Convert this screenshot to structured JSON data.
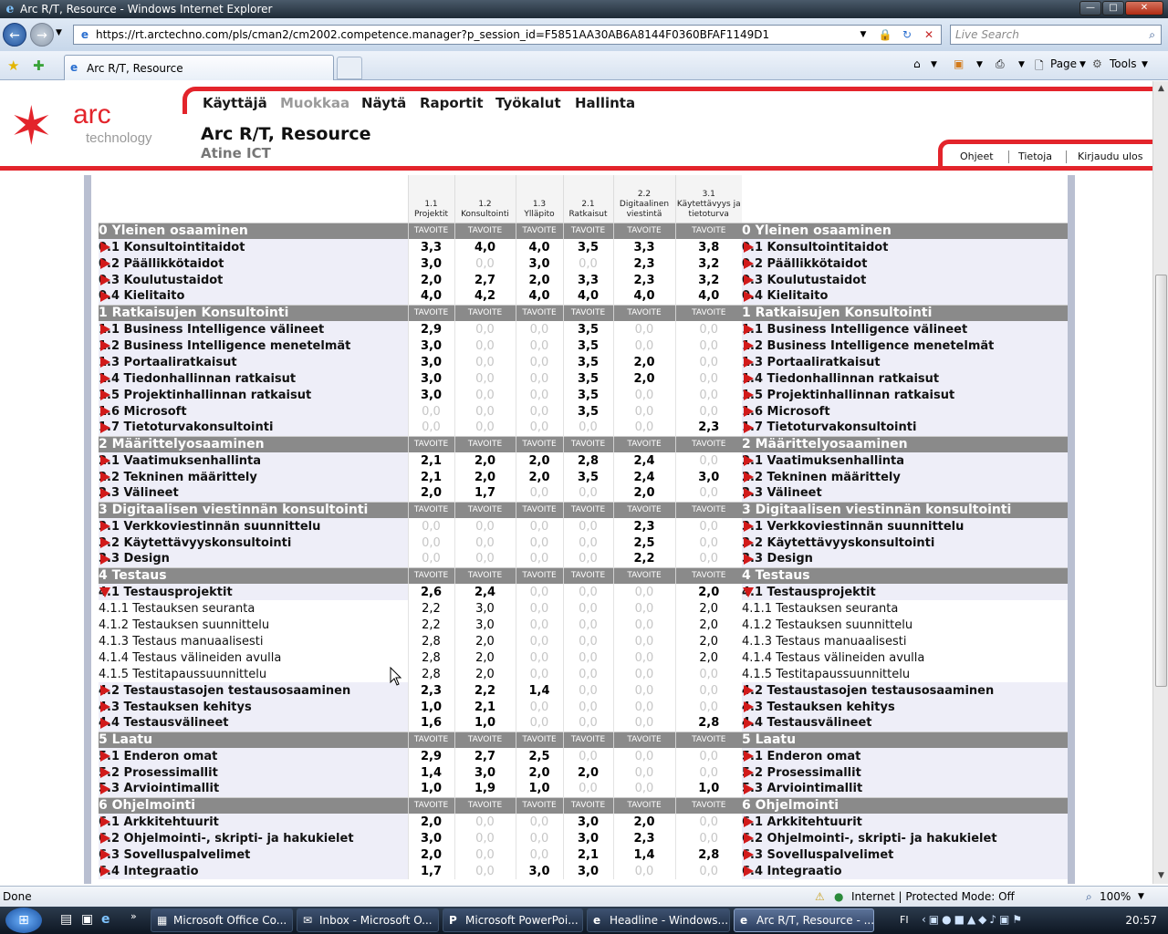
{
  "window": {
    "title": "Arc R/T, Resource - Windows Internet Explorer"
  },
  "browser": {
    "url": "https://rt.arctechno.com/pls/cman2/cm2002.competence.manager?p_session_id=F5851AA30AB6A8144F0360BFAF1149D1",
    "search_placeholder": "Live Search",
    "tab_title": "Arc R/T, Resource",
    "page_label": "Page",
    "tools_label": "Tools"
  },
  "app": {
    "logo_text": "arc",
    "logo_sub": "technology",
    "menu": [
      "Käyttäjä",
      "Muokkaa",
      "Näytä",
      "Raportit",
      "Työkalut",
      "Hallinta"
    ],
    "title": "Arc R/T, Resource",
    "subtitle": "Atine ICT",
    "top_links": [
      "Ohjeet",
      "Tietoja",
      "Kirjaudu ulos"
    ]
  },
  "grid": {
    "tav": "TAVOITE",
    "columns": [
      {
        "num": "1.1",
        "name": "Projektit"
      },
      {
        "num": "1.2",
        "name": "Konsultointi"
      },
      {
        "num": "1.3",
        "name": "Ylläpito"
      },
      {
        "num": "2.1",
        "name": "Ratkaisut"
      },
      {
        "num": "2.2",
        "name": "Digitaalinen viestintä"
      },
      {
        "num": "3.1",
        "name": "Käytettävyys ja tietoturva"
      }
    ],
    "rows": [
      {
        "type": "sec",
        "label": "0 Yleinen osaaminen"
      },
      {
        "label": "0.1 Konsultointitaidot",
        "values": [
          "3,3",
          "4,0",
          "4,0",
          "3,5",
          "3,3",
          "3,8"
        ]
      },
      {
        "label": "0.2 Päällikkötaidot",
        "values": [
          "3,0",
          "0,0",
          "3,0",
          "0,0",
          "2,3",
          "3,2"
        ]
      },
      {
        "label": "0.3 Koulutustaidot",
        "values": [
          "2,0",
          "2,7",
          "2,0",
          "3,3",
          "2,3",
          "3,2"
        ]
      },
      {
        "label": "0.4 Kielitaito",
        "values": [
          "4,0",
          "4,2",
          "4,0",
          "4,0",
          "4,0",
          "4,0"
        ]
      },
      {
        "type": "sec",
        "label": "1 Ratkaisujen Konsultointi"
      },
      {
        "label": "1.1 Business Intelligence välineet",
        "values": [
          "2,9",
          "0,0",
          "0,0",
          "3,5",
          "0,0",
          "0,0"
        ]
      },
      {
        "label": "1.2 Business Intelligence menetelmät",
        "values": [
          "3,0",
          "0,0",
          "0,0",
          "3,5",
          "0,0",
          "0,0"
        ]
      },
      {
        "label": "1.3 Portaaliratkaisut",
        "values": [
          "3,0",
          "0,0",
          "0,0",
          "3,5",
          "2,0",
          "0,0"
        ]
      },
      {
        "label": "1.4 Tiedonhallinnan ratkaisut",
        "values": [
          "3,0",
          "0,0",
          "0,0",
          "3,5",
          "2,0",
          "0,0"
        ]
      },
      {
        "label": "1.5 Projektinhallinnan ratkaisut",
        "values": [
          "3,0",
          "0,0",
          "0,0",
          "3,5",
          "0,0",
          "0,0"
        ]
      },
      {
        "label": "1.6 Microsoft",
        "values": [
          "0,0",
          "0,0",
          "0,0",
          "3,5",
          "0,0",
          "0,0"
        ]
      },
      {
        "label": "1.7 Tietoturvakonsultointi",
        "values": [
          "0,0",
          "0,0",
          "0,0",
          "0,0",
          "0,0",
          "2,3"
        ]
      },
      {
        "type": "sec",
        "label": "2 Määrittelyosaaminen"
      },
      {
        "label": "2.1 Vaatimuksenhallinta",
        "values": [
          "2,1",
          "2,0",
          "2,0",
          "2,8",
          "2,4",
          "0,0"
        ]
      },
      {
        "label": "2.2 Tekninen määrittely",
        "values": [
          "2,1",
          "2,0",
          "2,0",
          "3,5",
          "2,4",
          "3,0"
        ]
      },
      {
        "label": "2.3 Välineet",
        "values": [
          "2,0",
          "1,7",
          "0,0",
          "0,0",
          "2,0",
          "0,0"
        ]
      },
      {
        "type": "sec",
        "label": "3 Digitaalisen viestinnän konsultointi"
      },
      {
        "label": "3.1 Verkkoviestinnän suunnittelu",
        "values": [
          "0,0",
          "0,0",
          "0,0",
          "0,0",
          "2,3",
          "0,0"
        ]
      },
      {
        "label": "3.2 Käytettävyyskonsultointi",
        "values": [
          "0,0",
          "0,0",
          "0,0",
          "0,0",
          "2,5",
          "0,0"
        ]
      },
      {
        "label": "3.3 Design",
        "values": [
          "0,0",
          "0,0",
          "0,0",
          "0,0",
          "2,2",
          "0,0"
        ]
      },
      {
        "type": "sec",
        "label": "4 Testaus"
      },
      {
        "label": "4.1 Testausprojektit",
        "expanded": true,
        "values": [
          "2,6",
          "2,4",
          "0,0",
          "0,0",
          "0,0",
          "2,0"
        ]
      },
      {
        "sub": true,
        "label": "4.1.1 Testauksen seuranta",
        "values": [
          "2,2",
          "3,0",
          "0,0",
          "0,0",
          "0,0",
          "2,0"
        ]
      },
      {
        "sub": true,
        "label": "4.1.2 Testauksen suunnittelu",
        "values": [
          "2,2",
          "3,0",
          "0,0",
          "0,0",
          "0,0",
          "2,0"
        ]
      },
      {
        "sub": true,
        "label": "4.1.3 Testaus manuaalisesti",
        "values": [
          "2,8",
          "2,0",
          "0,0",
          "0,0",
          "0,0",
          "2,0"
        ]
      },
      {
        "sub": true,
        "label": "4.1.4 Testaus välineiden avulla",
        "values": [
          "2,8",
          "2,0",
          "0,0",
          "0,0",
          "0,0",
          "2,0"
        ]
      },
      {
        "sub": true,
        "label": "4.1.5 Testitapaussuunnittelu",
        "values": [
          "2,8",
          "2,0",
          "0,0",
          "0,0",
          "0,0",
          "0,0"
        ]
      },
      {
        "label": "4.2 Testaustasojen testausosaaminen",
        "values": [
          "2,3",
          "2,2",
          "1,4",
          "0,0",
          "0,0",
          "0,0"
        ]
      },
      {
        "label": "4.3 Testauksen kehitys",
        "values": [
          "1,0",
          "2,1",
          "0,0",
          "0,0",
          "0,0",
          "0,0"
        ]
      },
      {
        "label": "4.4 Testausvälineet",
        "values": [
          "1,6",
          "1,0",
          "0,0",
          "0,0",
          "0,0",
          "2,8"
        ]
      },
      {
        "type": "sec",
        "label": "5 Laatu"
      },
      {
        "label": "5.1 Enderon omat",
        "values": [
          "2,9",
          "2,7",
          "2,5",
          "0,0",
          "0,0",
          "0,0"
        ]
      },
      {
        "label": "5.2 Prosessimallit",
        "values": [
          "1,4",
          "3,0",
          "2,0",
          "2,0",
          "0,0",
          "0,0"
        ]
      },
      {
        "label": "5.3 Arviointimallit",
        "values": [
          "1,0",
          "1,9",
          "1,0",
          "0,0",
          "0,0",
          "1,0"
        ]
      },
      {
        "type": "sec",
        "label": "6 Ohjelmointi"
      },
      {
        "label": "6.1 Arkkitehtuurit",
        "values": [
          "2,0",
          "0,0",
          "0,0",
          "3,0",
          "2,0",
          "0,0"
        ]
      },
      {
        "label": "6.2 Ohjelmointi-, skripti- ja hakukielet",
        "values": [
          "3,0",
          "0,0",
          "0,0",
          "3,0",
          "2,3",
          "0,0"
        ]
      },
      {
        "label": "6.3 Sovelluspalvelimet",
        "values": [
          "2,0",
          "0,0",
          "0,0",
          "2,1",
          "1,4",
          "2,8"
        ]
      },
      {
        "label": "6.4 Integraatio",
        "values": [
          "1,7",
          "0,0",
          "3,0",
          "3,0",
          "0,0",
          "0,0"
        ]
      }
    ]
  },
  "status": {
    "text": "Done",
    "zone": "Internet | Protected Mode: Off",
    "zoom": "100%"
  },
  "taskbar": {
    "buttons": [
      {
        "label": "Microsoft Office Co...",
        "icon": "office-icon"
      },
      {
        "label": "Inbox - Microsoft O...",
        "icon": "outlook-icon"
      },
      {
        "label": "Microsoft PowerPoi...",
        "icon": "powerpoint-icon"
      },
      {
        "label": "Headline - Windows...",
        "icon": "ie-icon"
      },
      {
        "label": "Arc R/T, Resource - ...",
        "icon": "ie-icon",
        "active": true
      }
    ],
    "lang": "FI",
    "clock": "20:57"
  },
  "colors": {
    "brand_red": "#e3242b",
    "section_grey": "#8a8a8a"
  }
}
